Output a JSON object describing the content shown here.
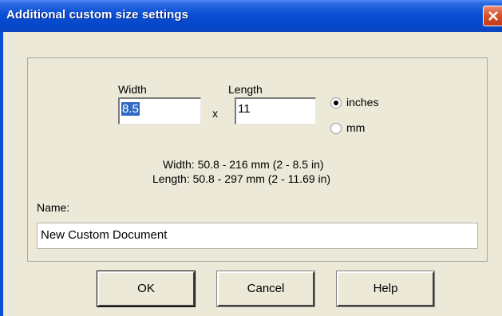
{
  "window": {
    "title": "Additional custom size settings"
  },
  "size": {
    "width_label": "Width",
    "length_label": "Length",
    "width_value": "8.5",
    "length_value": "11",
    "times_symbol": "x"
  },
  "units": {
    "inches_label": "inches",
    "mm_label": "mm",
    "selected": "inches"
  },
  "ranges": {
    "width_text": "Width: 50.8 - 216 mm  (2 - 8.5 in)",
    "length_text": "Length: 50.8 - 297 mm  (2 - 11.69 in)"
  },
  "name": {
    "label": "Name:",
    "value": "New Custom Document"
  },
  "buttons": {
    "ok": "OK",
    "cancel": "Cancel",
    "help": "Help"
  },
  "icons": {
    "close": "close-icon"
  },
  "colors": {
    "titlebar": "#0a4fd6",
    "close_button": "#d9502a",
    "selection": "#316ac5",
    "dialog_bg": "#ece9d8"
  }
}
